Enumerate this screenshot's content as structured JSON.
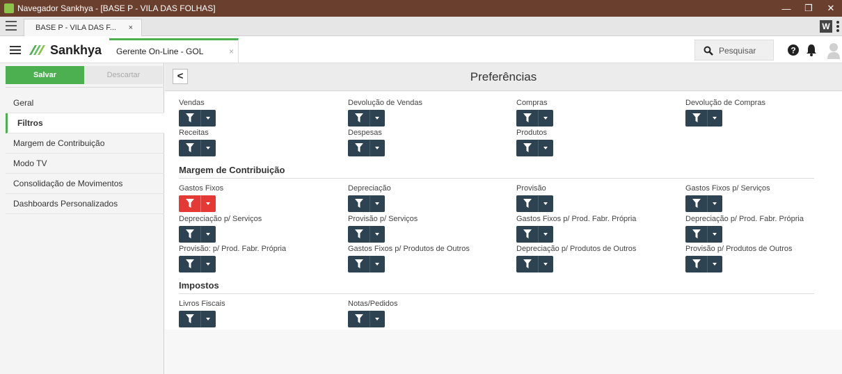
{
  "window": {
    "title": "Navegador Sankhya - [BASE P - VILA DAS FOLHAS]"
  },
  "browser_tab": {
    "label": "BASE P - VILA DAS F...",
    "close": "×"
  },
  "header": {
    "brand": "Sankhya",
    "app_tab": "Gerente On-Line - GOL",
    "app_tab_close": "×",
    "search_placeholder": "Pesquisar"
  },
  "sidebar": {
    "save_label": "Salvar",
    "discard_label": "Descartar",
    "items": [
      {
        "label": "Geral"
      },
      {
        "label": "Filtros"
      },
      {
        "label": "Margem de Contribuição"
      },
      {
        "label": "Modo TV"
      },
      {
        "label": "Consolidação de Movimentos"
      },
      {
        "label": "Dashboards Personalizados"
      }
    ],
    "active_index": 1
  },
  "main": {
    "title": "Preferências",
    "back": "<",
    "fields_top": [
      "Vendas",
      "Devolução de Vendas",
      "Compras",
      "Devolução de Compras",
      "Receitas",
      "Despesas",
      "Produtos"
    ],
    "section_margem": "Margem de Contribuição",
    "fields_margem": [
      "Gastos Fixos",
      "Depreciação",
      "Provisão",
      "Gastos Fixos p/ Serviços",
      "Depreciação p/ Serviços",
      "Provisão p/ Serviços",
      "Gastos Fixos p/ Prod. Fabr. Própria",
      "Depreciação p/ Prod. Fabr. Própria",
      "Provisão: p/ Prod. Fabr. Própria",
      "Gastos Fixos p/ Produtos de Outros",
      "Depreciação p/ Produtos de Outros",
      "Provisão p/ Produtos de Outros"
    ],
    "section_impostos": "Impostos",
    "fields_impostos": [
      "Livros Fiscais",
      "Notas/Pedidos"
    ]
  },
  "colors": {
    "accent": "#4caf50",
    "filter_button": "#2e4352",
    "filter_active": "#e53935",
    "titlebar": "#6b3f2e"
  }
}
